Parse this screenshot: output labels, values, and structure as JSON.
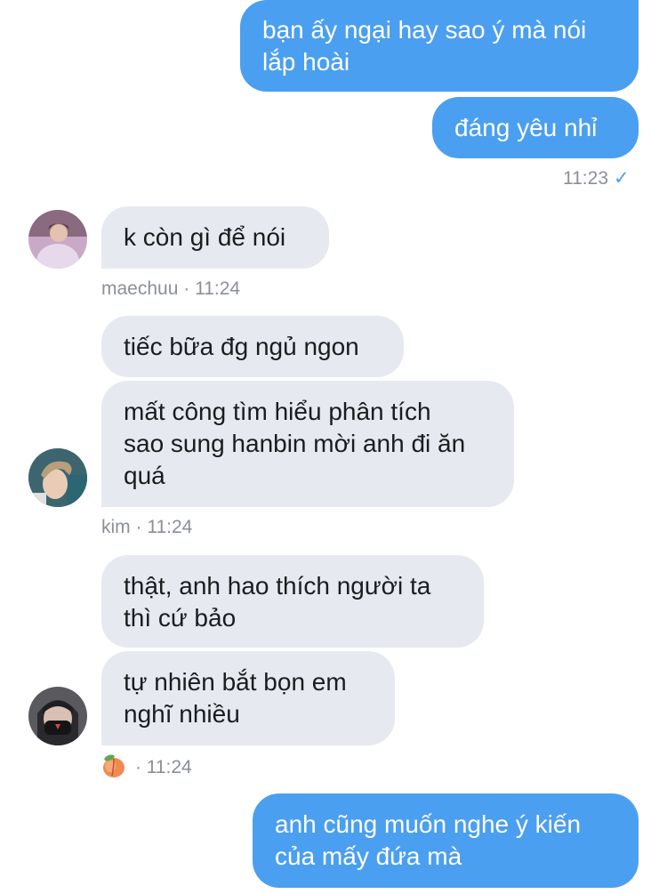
{
  "messages": {
    "out1": "bạn ấy ngại hay sao ý mà nói\nlắp hoài",
    "out2": "đáng yêu nhỉ",
    "out_time": "11:23",
    "out_status": "✓",
    "m1_text": "k còn gì để nói",
    "m1_sender": "maechuu",
    "m1_time": "11:24",
    "k1_text": "tiếc bữa đg ngủ ngon",
    "k2_text": "mất công tìm hiểu phân tích\nsao sung hanbin mời anh đi ăn\nquá",
    "k_sender": "kim",
    "k_time": "11:24",
    "p1_text": "thật, anh hao thích người ta\nthì cứ bảo",
    "p2_text": "tự nhiên bắt bọn em\nnghĩ nhiều",
    "p_time": "11:24",
    "out3": "anh cũng muốn nghe ý kiến\ncủa mấy đứa mà"
  },
  "meta": {
    "separator": "·"
  },
  "icons": {
    "peach": "peach-emoji-icon",
    "check": "read-check-icon"
  },
  "colors": {
    "sent_bubble": "#4a9ff0",
    "received_bubble": "#e6e9f0",
    "meta_text": "#8a8f98"
  }
}
